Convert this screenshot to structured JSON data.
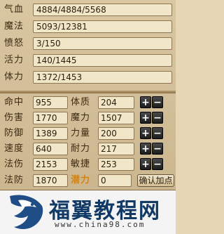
{
  "bars": [
    {
      "label": "气血",
      "value": "4884/4884/5568"
    },
    {
      "label": "魔法",
      "value": "5093/12381"
    },
    {
      "label": "愤怒",
      "value": "3/150"
    },
    {
      "label": "活力",
      "value": "140/1445"
    },
    {
      "label": "体力",
      "value": "1372/1453"
    }
  ],
  "left_stats": [
    {
      "label": "命中",
      "value": "955"
    },
    {
      "label": "伤害",
      "value": "1770"
    },
    {
      "label": "防御",
      "value": "1389"
    },
    {
      "label": "速度",
      "value": "640"
    },
    {
      "label": "法伤",
      "value": "2153"
    },
    {
      "label": "法防",
      "value": "1870"
    }
  ],
  "right_stats": [
    {
      "label": "体质",
      "value": "204"
    },
    {
      "label": "魔力",
      "value": "1507"
    },
    {
      "label": "力量",
      "value": "200"
    },
    {
      "label": "耐力",
      "value": "217"
    },
    {
      "label": "敏捷",
      "value": "253"
    }
  ],
  "potential": {
    "label": "潜力",
    "value": "0"
  },
  "buttons": {
    "plus": "+",
    "minus": "−",
    "confirm": "确认加点"
  },
  "watermark": {
    "title": "福翼教程网",
    "url": "www.china98.com"
  }
}
